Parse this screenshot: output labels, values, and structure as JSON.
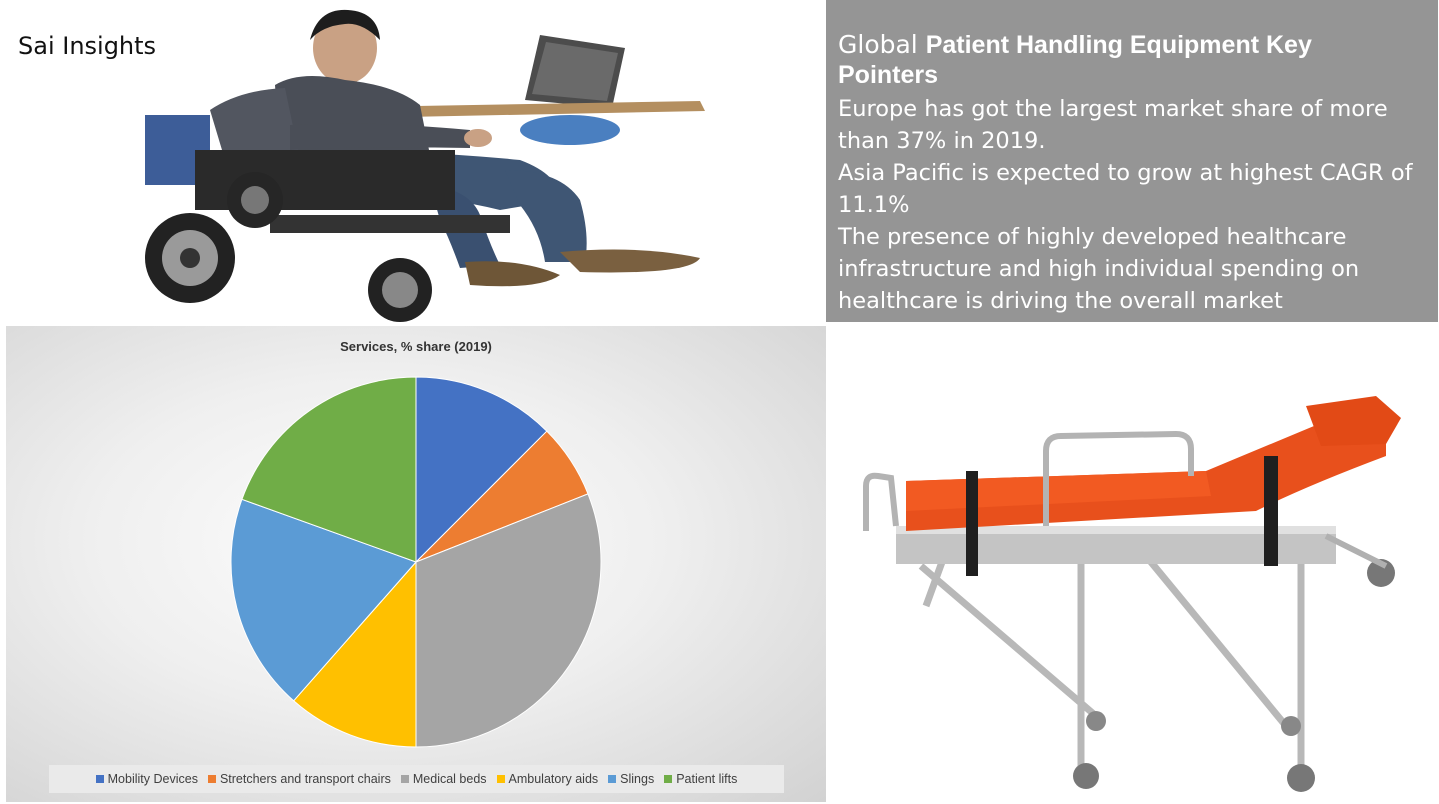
{
  "brand": "Sai Insights",
  "pointers": {
    "title_prefix": "Global ",
    "title_bold": "Patient Handling Equipment Key Pointers",
    "lines": [
      "Europe has got the largest market share of more than 37% in 2019.",
      "Asia Pacific is expected to grow at highest CAGR of 11.1%",
      "The presence of highly developed healthcare infrastructure and high individual spending on healthcare is driving the overall market"
    ]
  },
  "chart_data": {
    "type": "pie",
    "title": "Services, % share (2019)",
    "categories": [
      "Mobility Devices",
      "Stretchers and transport chairs",
      "Medical beds",
      "Ambulatory aids",
      "Slings",
      "Patient lifts"
    ],
    "values": [
      12.5,
      6.5,
      31,
      11.5,
      19,
      19.5
    ],
    "colors": [
      "#4472C4",
      "#ED7D31",
      "#A5A5A5",
      "#FFC000",
      "#5B9BD5",
      "#70AD47"
    ],
    "legend_position": "bottom",
    "start_angle": "12 o'clock",
    "direction": "clockwise"
  },
  "images": {
    "wheelchair": "person-in-wheelchair-with-laptop",
    "stretcher": "ambulance-stretcher"
  }
}
